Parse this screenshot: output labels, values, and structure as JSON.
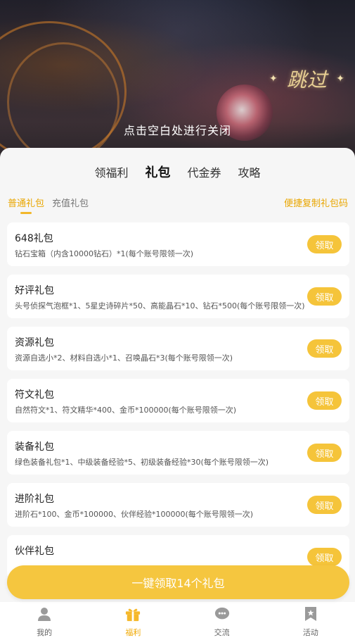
{
  "overlay": {
    "skip_label": "跳过",
    "close_hint": "点击空白处进行关闭"
  },
  "main_tabs": [
    {
      "label": "领福利",
      "active": false
    },
    {
      "label": "礼包",
      "active": true
    },
    {
      "label": "代金券",
      "active": false
    },
    {
      "label": "攻略",
      "active": false
    }
  ],
  "sub_tabs": [
    {
      "label": "普通礼包",
      "active": true
    },
    {
      "label": "充值礼包",
      "active": false
    }
  ],
  "copy_link_label": "便捷复制礼包码",
  "gifts": [
    {
      "title": "648礼包",
      "desc": "钻石宝箱（内含10000钻石）*1(每个账号限领一次)",
      "button": "领取"
    },
    {
      "title": "好评礼包",
      "desc": "头号侦探气泡框*1、5星史诗碎片*50、高能晶石*10、钻石*500(每个账号限领一次)",
      "button": "领取"
    },
    {
      "title": "资源礼包",
      "desc": "资源自选小*2、材料自选小*1、召唤晶石*3(每个账号限领一次)",
      "button": "领取"
    },
    {
      "title": "符文礼包",
      "desc": "自然符文*1、符文精华*400、金币*100000(每个账号限领一次)",
      "button": "领取"
    },
    {
      "title": "装备礼包",
      "desc": "绿色装备礼包*1、中级装备经验*5、初级装备经验*30(每个账号限领一次)",
      "button": "领取"
    },
    {
      "title": "进阶礼包",
      "desc": "进阶石*100、金币*100000、伙伴经验*100000(每个账号限领一次)",
      "button": "领取"
    },
    {
      "title": "伙伴礼包",
      "desc": "",
      "button": "领取"
    }
  ],
  "claim_all_label": "一键领取14个礼包",
  "nav": [
    {
      "label": "我的",
      "icon": "user-icon",
      "active": false
    },
    {
      "label": "福利",
      "icon": "gift-icon",
      "active": true
    },
    {
      "label": "交流",
      "icon": "chat-icon",
      "active": false
    },
    {
      "label": "活动",
      "icon": "bookmark-icon",
      "active": false
    }
  ],
  "colors": {
    "accent": "#f5c43a",
    "accent_text": "#e9a600",
    "sheet_bg": "#f6f6f6"
  }
}
